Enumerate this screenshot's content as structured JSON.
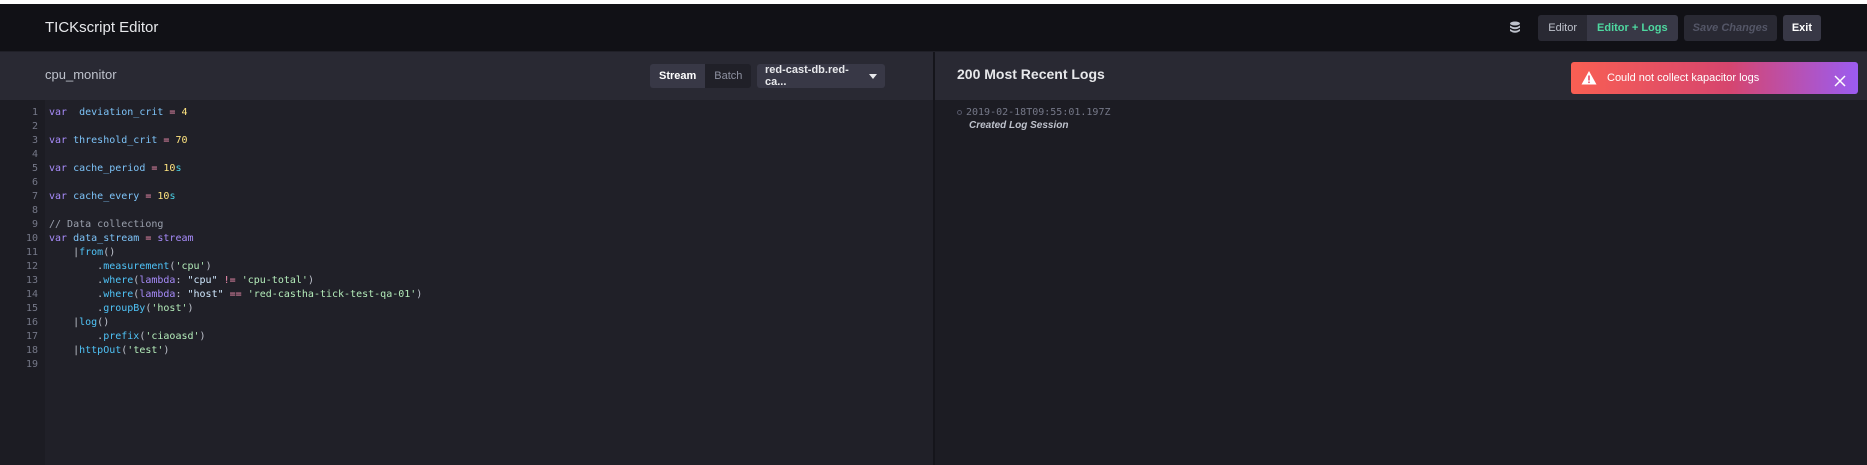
{
  "header": {
    "title": "TICKscript Editor",
    "actions": {
      "editor_label": "Editor",
      "editor_logs_label": "Editor + Logs",
      "save_label": "Save Changes",
      "exit_label": "Exit"
    }
  },
  "editor": {
    "script_name": "cpu_monitor",
    "type_toggle": {
      "stream_label": "Stream",
      "batch_label": "Batch",
      "selected": "Stream"
    },
    "database_selected": "red-cast-db.red-ca...",
    "line_numbers": [
      "1",
      "2",
      "3",
      "4",
      "5",
      "6",
      "7",
      "8",
      "9",
      "10",
      "11",
      "12",
      "13",
      "14",
      "15",
      "16",
      "17",
      "18",
      "19"
    ],
    "lines": [
      [
        "var ",
        " deviation_crit",
        " = ",
        "4"
      ],
      [],
      [
        "var ",
        "threshold_crit",
        " = ",
        "70"
      ],
      [],
      [
        "var ",
        "cache_period",
        " = ",
        "10",
        "s"
      ],
      [],
      [
        "var ",
        "cache_every",
        " = ",
        "10",
        "s"
      ],
      [],
      [
        "// Data collectiong"
      ],
      [
        "var ",
        "data_stream",
        " = ",
        "stream"
      ],
      [
        "    |",
        "from",
        "()"
      ],
      [
        "        .",
        "measurement",
        "(",
        "'cpu'",
        ")"
      ],
      [
        "        .",
        "where",
        "(",
        "lambda",
        ": ",
        "\"cpu\"",
        " != ",
        "'cpu-total'",
        ")"
      ],
      [
        "        .",
        "where",
        "(",
        "lambda",
        ": ",
        "\"host\"",
        " == ",
        "'red-castha-tick-test-qa-01'",
        ")"
      ],
      [
        "        .",
        "groupBy",
        "(",
        "'host'",
        ")"
      ],
      [
        "    |",
        "log",
        "()"
      ],
      [
        "        .",
        "prefix",
        "(",
        "'ciaoasd'",
        ")"
      ],
      [
        "    |",
        "httpOut",
        "(",
        "'test'",
        ")"
      ],
      []
    ]
  },
  "logs": {
    "title": "200 Most Recent Logs",
    "entries": [
      {
        "timestamp": "2019-02-18T09:55:01.197Z",
        "message": "Created Log Session"
      }
    ]
  },
  "notification": {
    "text": "Could not collect kapacitor logs",
    "icon": "alert-triangle-icon"
  },
  "colors": {
    "accent_green": "#4ed8a0",
    "toast_start": "#f95f53",
    "toast_end": "#9b5cf1"
  }
}
